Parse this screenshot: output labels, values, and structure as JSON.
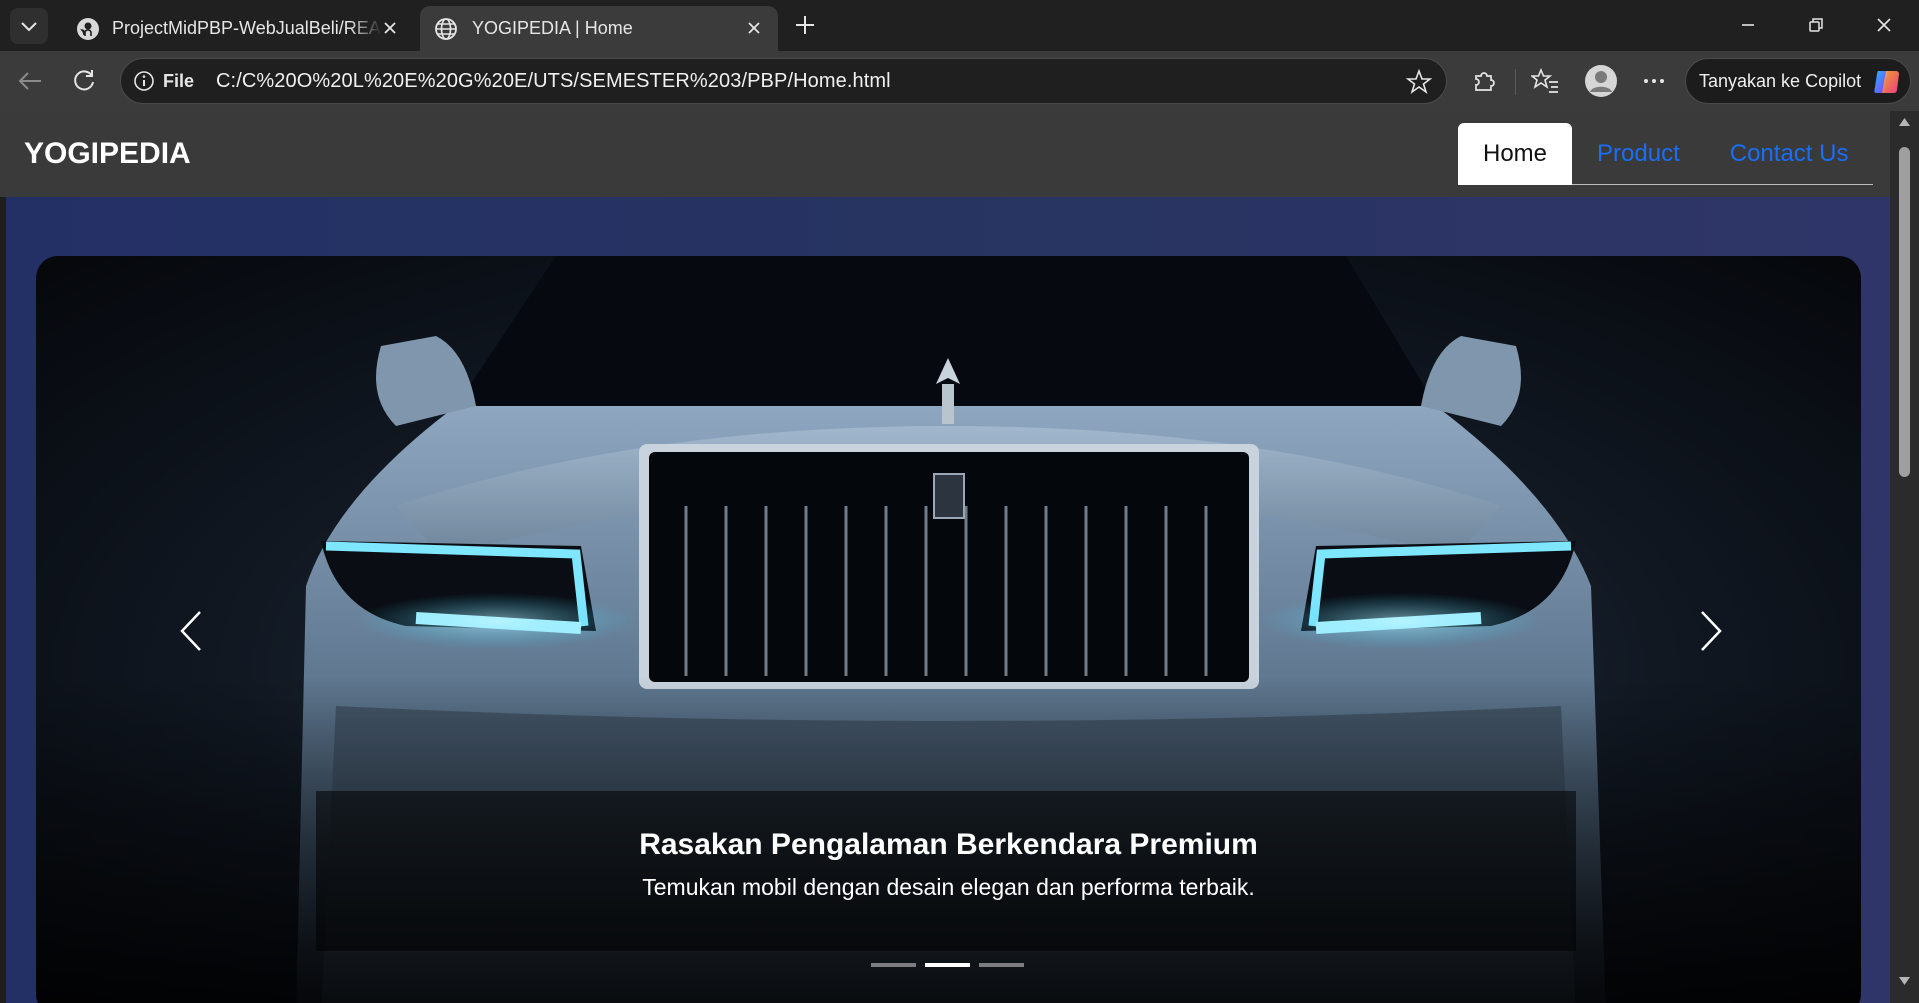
{
  "browser": {
    "tabs": [
      {
        "title": "ProjectMidPBP-WebJualBeli/README",
        "icon": "github-icon"
      },
      {
        "title": "YOGIPEDIA | Home",
        "icon": "globe-icon",
        "active": true
      }
    ],
    "address": {
      "scheme_label": "File",
      "url": "C:/C%20O%20L%20E%20G%20E/UTS/SEMESTER%203/PBP/Home.html"
    },
    "copilot_label": "Tanyakan ke Copilot"
  },
  "site": {
    "brand": "YOGIPEDIA",
    "nav": [
      {
        "label": "Home",
        "active": true
      },
      {
        "label": "Product"
      },
      {
        "label": "Contact Us"
      }
    ],
    "hero": {
      "title": "Rasakan Pengalaman Berkendara Premium",
      "subtitle": "Temukan mobil dengan desain elegan dan performa terbaik.",
      "slide_count": 3,
      "active_slide": 2
    }
  },
  "colors": {
    "nav_link": "#1a6ef5",
    "hero_background": "#233066",
    "headlight": "#7fe6ff"
  }
}
